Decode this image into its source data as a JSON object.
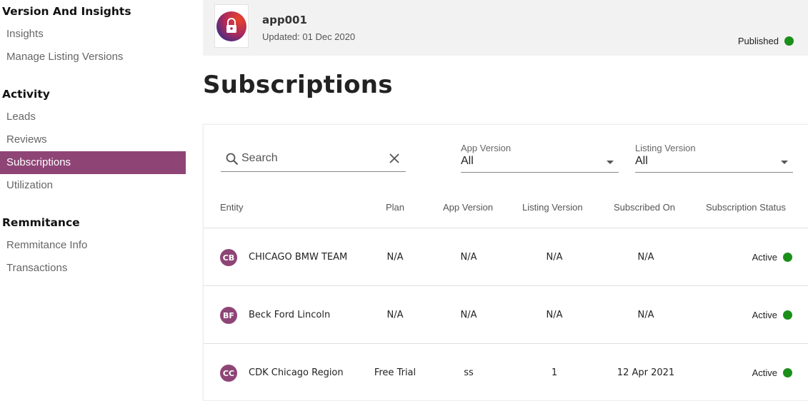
{
  "sidebar": {
    "sections": [
      {
        "title": "Version And Insights",
        "items": [
          "Insights",
          "Manage Listing Versions"
        ]
      },
      {
        "title": "Activity",
        "items": [
          "Leads",
          "Reviews",
          "Subscriptions",
          "Utilization"
        ]
      },
      {
        "title": "Remmitance",
        "items": [
          "Remmitance Info",
          "Transactions"
        ]
      }
    ]
  },
  "header": {
    "app_name": "app001",
    "updated": "Updated: 01 Dec 2020",
    "status": "Published",
    "status_color": "#1a8f1a"
  },
  "page": {
    "title": "Subscriptions"
  },
  "filters": {
    "search_placeholder": "Search",
    "app_version": {
      "label": "App Version",
      "value": "All"
    },
    "listing_version": {
      "label": "Listing Version",
      "value": "All"
    }
  },
  "table": {
    "columns": [
      "Entity",
      "Plan",
      "App Version",
      "Listing Version",
      "Subscribed On",
      "Subscription Status"
    ],
    "rows": [
      {
        "initials": "CB",
        "entity": "CHICAGO BMW TEAM",
        "plan": "N/A",
        "app_version": "N/A",
        "listing_version": "N/A",
        "subscribed_on": "N/A",
        "status": "Active"
      },
      {
        "initials": "BF",
        "entity": "Beck Ford Lincoln",
        "plan": "N/A",
        "app_version": "N/A",
        "listing_version": "N/A",
        "subscribed_on": "N/A",
        "status": "Active"
      },
      {
        "initials": "CC",
        "entity": "CDK Chicago Region",
        "plan": "Free Trial",
        "app_version": "ss",
        "listing_version": "1",
        "subscribed_on": "12 Apr 2021",
        "status": "Active"
      }
    ]
  },
  "colors": {
    "accent": "#8e4576",
    "active_green": "#1a8f1a"
  }
}
